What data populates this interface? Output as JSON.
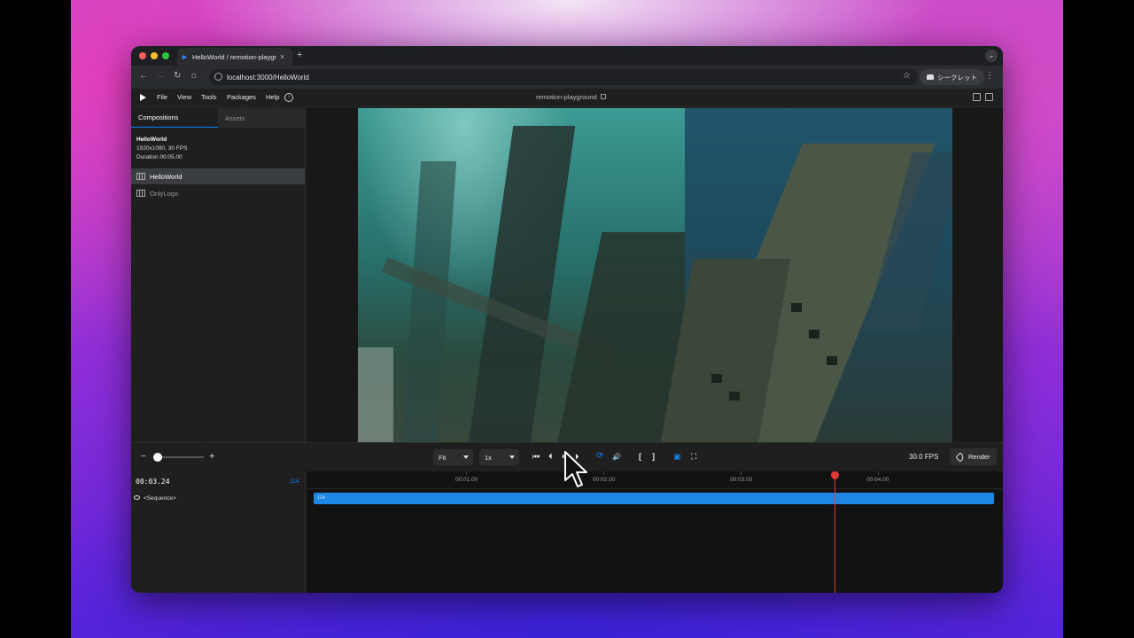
{
  "browser": {
    "tab_title": "HelloWorld / remotion-playground",
    "tab_close": "×",
    "new_tab": "+",
    "url": "localhost:3000/HelloWorld",
    "profile_label": "シークレット",
    "nav": {
      "back": "←",
      "forward": "→",
      "reload": "↻",
      "home": "⌂",
      "bookmark": "☆",
      "menu": "⋮",
      "tab_search": "⌄"
    }
  },
  "menubar": {
    "items": [
      "File",
      "View",
      "Tools",
      "Packages",
      "Help"
    ],
    "project_name": "remotion-playground"
  },
  "sidebar": {
    "tabs": [
      "Compositions",
      "Assets"
    ],
    "current": {
      "name": "HelloWorld",
      "resolution": "1920x1080, 30 FPS",
      "duration": "Duration 00:05.00"
    },
    "compositions": [
      "HelloWorld",
      "OnlyLogo"
    ]
  },
  "controls": {
    "zoom_minus": "−",
    "zoom_plus": "+",
    "size_mode": "Fit",
    "playback_rate": "1x",
    "icons": {
      "jump_start": "⏮",
      "prev_frame": "⏴",
      "play_pause": "⏸",
      "next_frame": "⏵",
      "loop": "⟳",
      "volume": "🔊",
      "in_point": "[",
      "out_point": "]",
      "checkerboard": "▣",
      "fullscreen": "⛶"
    },
    "fps": "30.0 FPS",
    "render_label": "Render"
  },
  "timeline": {
    "timecode": "00:03.24",
    "frame": "114",
    "track_name": "<Sequence>",
    "sequence_label": "114",
    "ruler_labels": [
      "00:01.00",
      "00:02.00",
      "00:03.00",
      "00:04.00"
    ]
  },
  "colors": {
    "accent": "#0b84f3",
    "playhead": "#e53935",
    "sequence": "#1e88e5"
  }
}
